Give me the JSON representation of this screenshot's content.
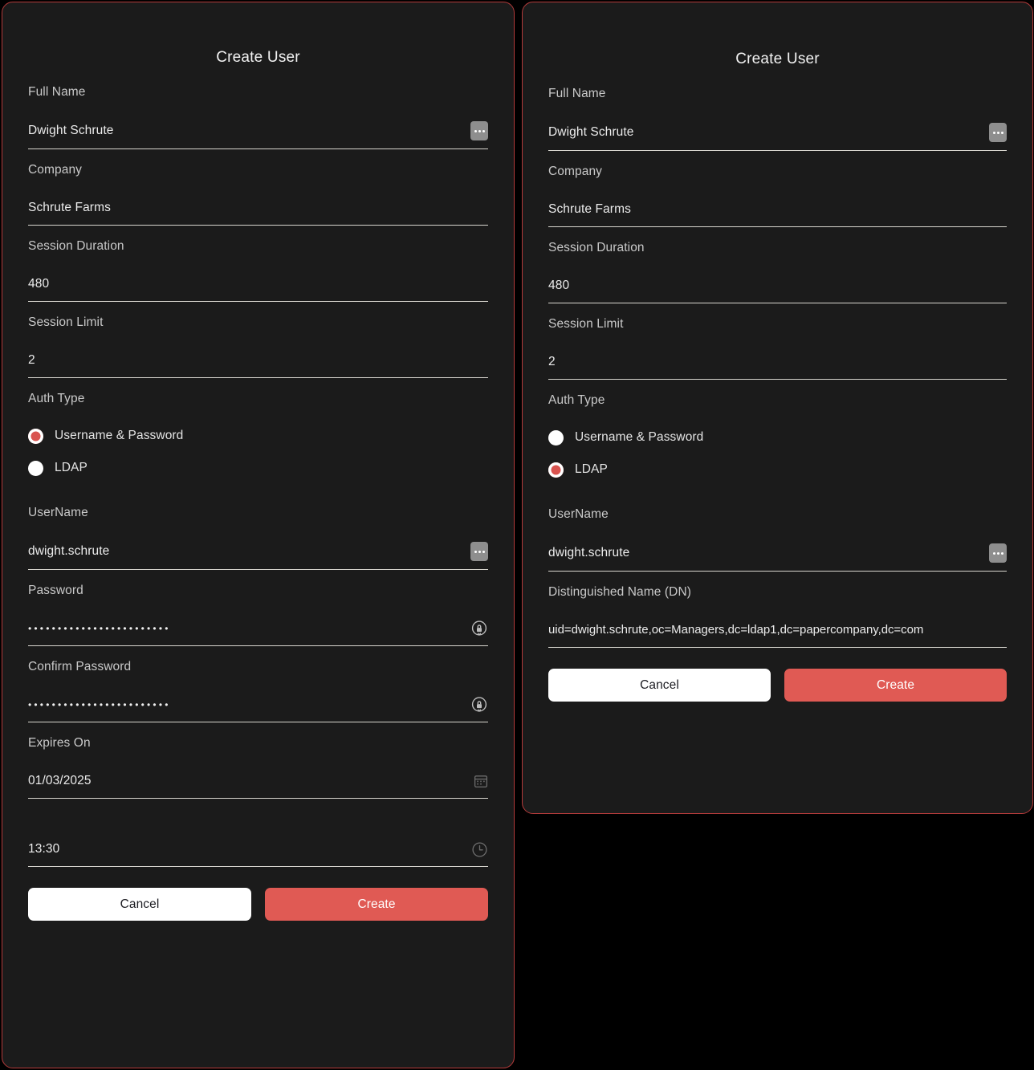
{
  "theme": {
    "page_background": "#000000",
    "panel_background": "#1b1b1b",
    "panel_border": "#b33a3a",
    "accent": "#e05a54",
    "label_color": "#c9c9c9",
    "value_color": "#ececec",
    "underline_color": "#d8d6cf"
  },
  "panels": [
    {
      "id": "create-user-password",
      "title": "Create User",
      "fields": {
        "full_name": {
          "label": "Full Name",
          "value": "Dwight Schrute"
        },
        "company": {
          "label": "Company",
          "value": "Schrute Farms"
        },
        "session_duration": {
          "label": "Session Duration",
          "value": "480"
        },
        "session_limit": {
          "label": "Session Limit",
          "value": "2"
        },
        "auth_type": {
          "label": "Auth Type"
        },
        "username": {
          "label": "UserName",
          "value": "dwight.schrute"
        },
        "password": {
          "label": "Password",
          "value": "••••••••••••••••••••••••"
        },
        "confirm_password": {
          "label": "Confirm Password",
          "value": "••••••••••••••••••••••••"
        },
        "expires_on": {
          "label": "Expires On",
          "value": "01/03/2025"
        },
        "expires_time": {
          "label": "",
          "value": "13:30"
        }
      },
      "auth_options": [
        {
          "label": "Username & Password",
          "selected": true
        },
        {
          "label": "LDAP",
          "selected": false
        }
      ],
      "buttons": {
        "cancel": "Cancel",
        "create": "Create"
      }
    },
    {
      "id": "create-user-ldap",
      "title": "Create User",
      "fields": {
        "full_name": {
          "label": "Full Name",
          "value": "Dwight Schrute"
        },
        "company": {
          "label": "Company",
          "value": "Schrute Farms"
        },
        "session_duration": {
          "label": "Session Duration",
          "value": "480"
        },
        "session_limit": {
          "label": "Session Limit",
          "value": "2"
        },
        "auth_type": {
          "label": "Auth Type"
        },
        "username": {
          "label": "UserName",
          "value": "dwight.schrute"
        },
        "dn": {
          "label": "Distinguished Name (DN)",
          "value": "uid=dwight.schrute,oc=Managers,dc=ldap1,dc=papercompany,dc=com"
        }
      },
      "auth_options": [
        {
          "label": "Username & Password",
          "selected": false
        },
        {
          "label": "LDAP",
          "selected": true
        }
      ],
      "buttons": {
        "cancel": "Cancel",
        "create": "Create"
      }
    }
  ],
  "icons": {
    "more": "ellipsis-icon",
    "password": "lock-circle-icon",
    "date": "calendar-icon",
    "time": "clock-icon"
  }
}
